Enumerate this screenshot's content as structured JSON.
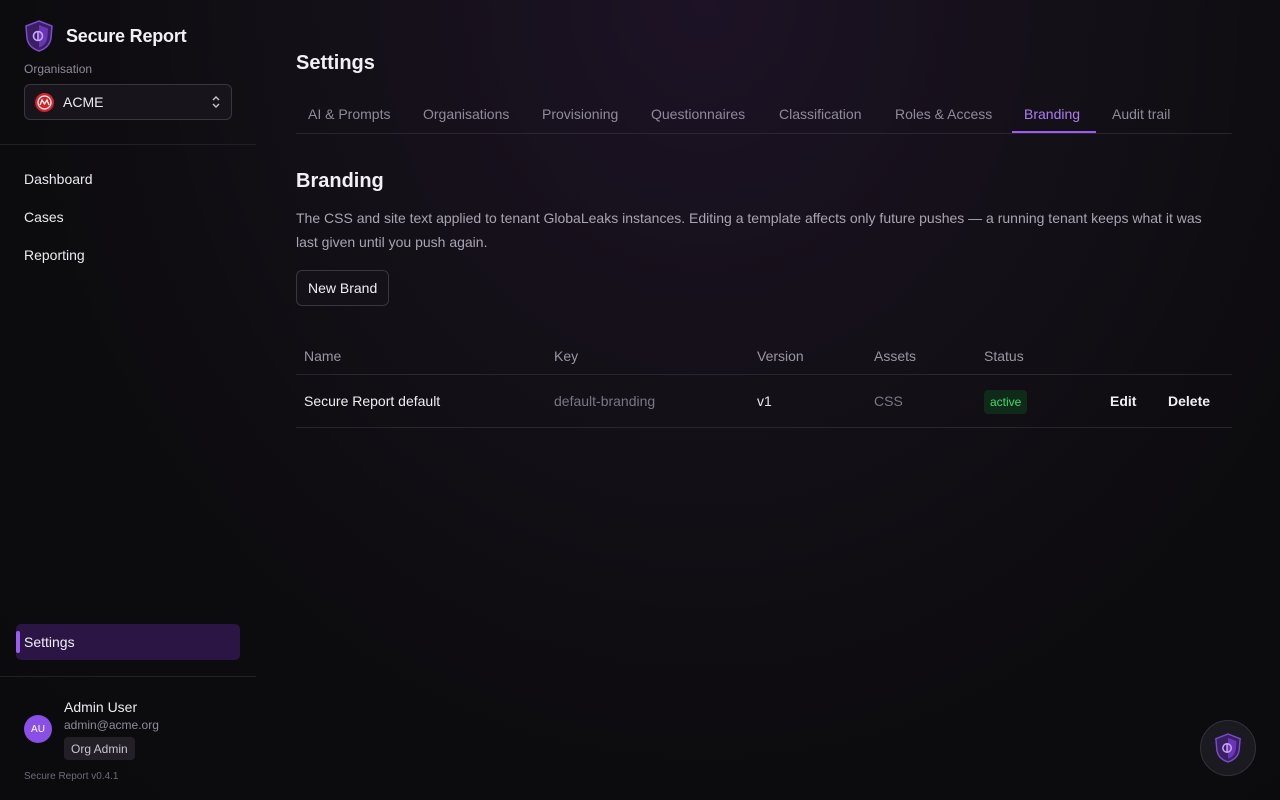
{
  "app": {
    "name": "Secure Report",
    "version": "Secure Report v0.4.1"
  },
  "org": {
    "label": "Organisation",
    "selected": "ACME",
    "logo_text": "ACME"
  },
  "nav": {
    "items": [
      "Dashboard",
      "Cases",
      "Reporting"
    ],
    "settings": "Settings"
  },
  "user": {
    "name": "Admin User",
    "email": "admin@acme.org",
    "role": "Org Admin",
    "initials": "AU"
  },
  "page": {
    "title": "Settings"
  },
  "tabs": [
    {
      "label": "AI & Prompts",
      "active": false
    },
    {
      "label": "Organisations",
      "active": false
    },
    {
      "label": "Provisioning",
      "active": false
    },
    {
      "label": "Questionnaires",
      "active": false
    },
    {
      "label": "Classification",
      "active": false
    },
    {
      "label": "Roles & Access",
      "active": false
    },
    {
      "label": "Branding",
      "active": true
    },
    {
      "label": "Audit trail",
      "active": false
    }
  ],
  "section": {
    "title": "Branding",
    "description": "The CSS and site text applied to tenant GlobaLeaks instances. Editing a template affects only future pushes — a running tenant keeps what it was last given until you push again.",
    "new_button": "New Brand"
  },
  "table": {
    "headers": [
      "Name",
      "Key",
      "Version",
      "Assets",
      "Status"
    ],
    "rows": [
      {
        "name": "Secure Report default",
        "key": "default-branding",
        "version": "v1",
        "assets": "CSS",
        "status": "active",
        "edit": "Edit",
        "delete": "Delete"
      }
    ]
  },
  "colors": {
    "accent": "#9a5cf3",
    "status_active": "#3ddc6e",
    "org_logo": "#d4232b"
  }
}
